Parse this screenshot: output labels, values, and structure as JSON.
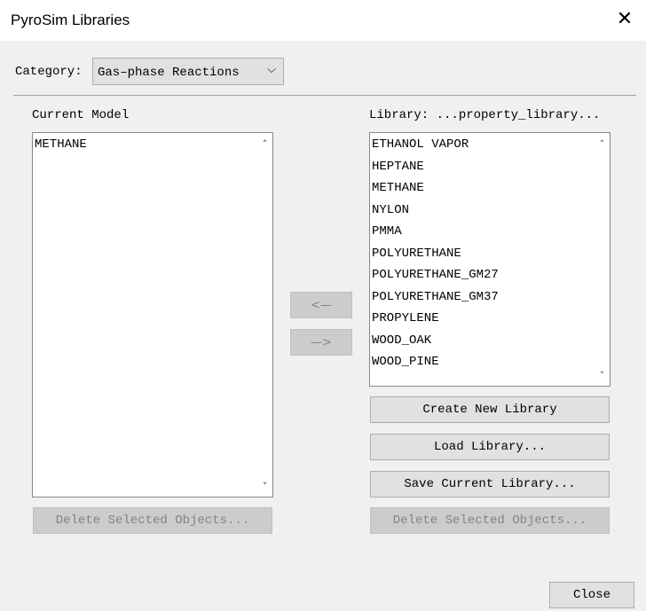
{
  "window": {
    "title": "PyroSim Libraries",
    "close_glyph": "✕"
  },
  "category": {
    "label": "Category:",
    "selected": "Gas–phase Reactions",
    "dropdown_glyph": "⌄"
  },
  "current_model": {
    "header": "Current Model",
    "items": [
      "METHANE"
    ],
    "delete_label": "Delete Selected Objects..."
  },
  "library": {
    "header": "Library: ...property_library...",
    "items": [
      "ETHANOL VAPOR",
      "HEPTANE",
      "METHANE",
      "NYLON",
      "PMMA",
      "POLYURETHANE",
      "POLYURETHANE_GM27",
      "POLYURETHANE_GM37",
      "PROPYLENE",
      "WOOD_OAK",
      "WOOD_PINE"
    ],
    "create_label": "Create New Library",
    "load_label": "Load Library...",
    "save_label": "Save Current Library...",
    "delete_label": "Delete Selected Objects..."
  },
  "transfer": {
    "left_label": "<—",
    "right_label": "—>"
  },
  "scroll": {
    "up_glyph": "▲",
    "down_glyph": "▼"
  },
  "footer": {
    "close_label": "Close"
  }
}
